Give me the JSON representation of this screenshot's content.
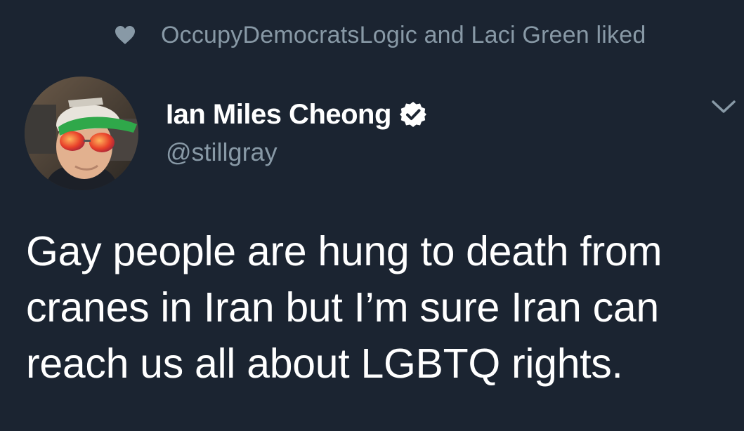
{
  "context": {
    "text": "OccupyDemocratsLogic and Laci Green liked",
    "icon": "heart-icon"
  },
  "author": {
    "name": "Ian Miles Cheong",
    "handle": "@stillgray",
    "verified": true
  },
  "tweet": {
    "text": "Gay people are hung to death from cranes in Iran but I’m sure Iran can reach us all about LGBTQ rights."
  },
  "menu": {
    "icon": "chevron-down-icon"
  },
  "colors": {
    "background": "#1b2431",
    "secondary_text": "#8899a6",
    "primary_text": "#ffffff",
    "verified": "#ffffff"
  }
}
